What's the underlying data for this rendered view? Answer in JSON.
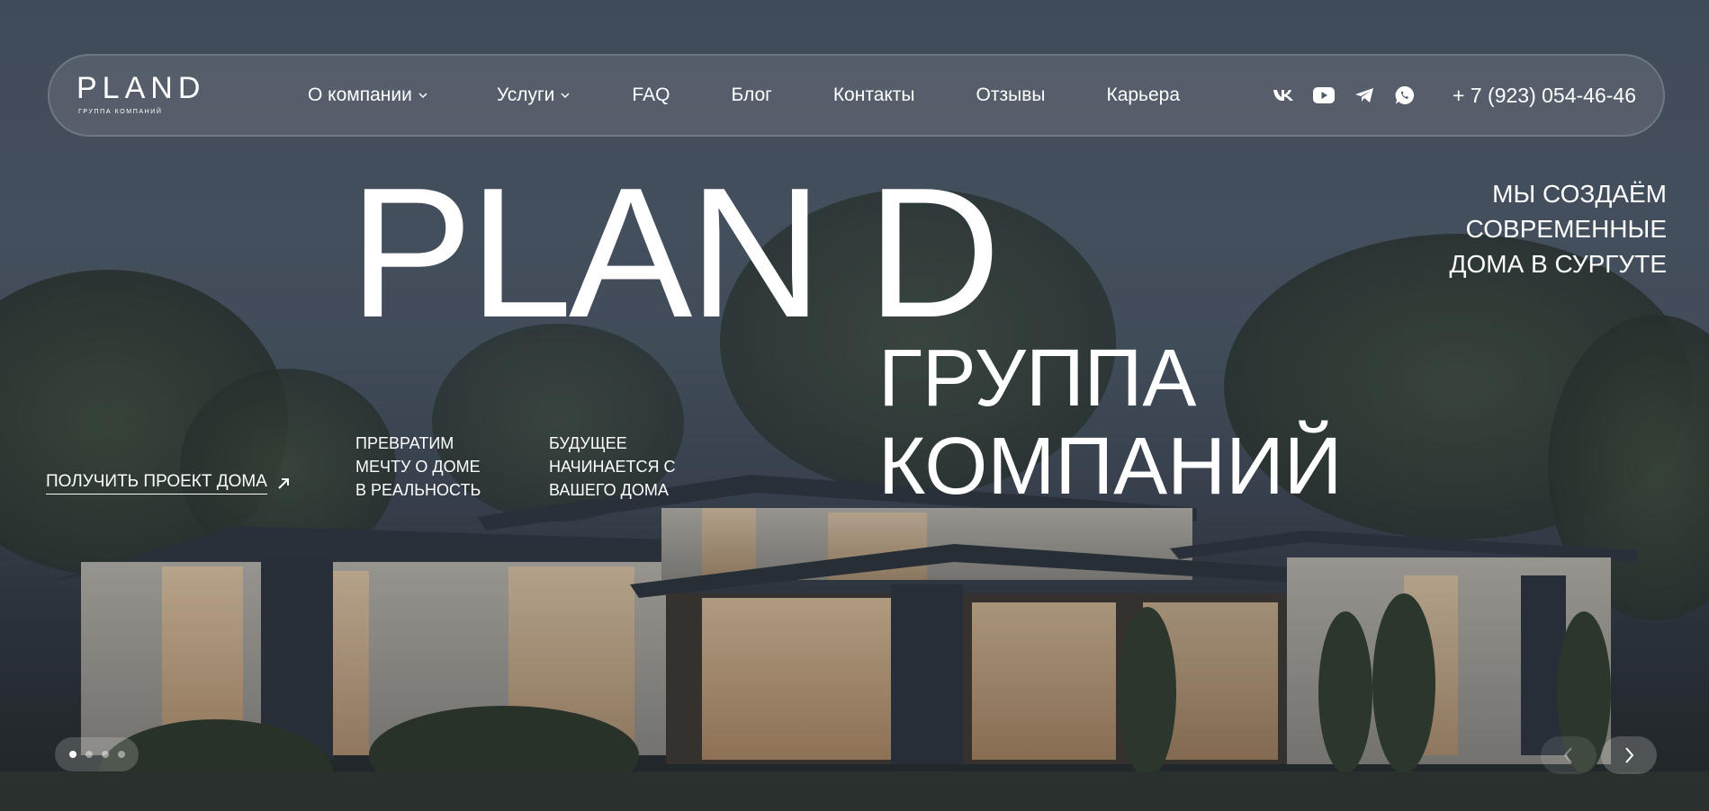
{
  "nav": {
    "logo_text": "PLAND",
    "logo_sub": "ГРУППА КОМПАНИЙ",
    "items": [
      {
        "label": "О компании",
        "dropdown": true
      },
      {
        "label": "Услуги",
        "dropdown": true
      },
      {
        "label": "FAQ",
        "dropdown": false
      },
      {
        "label": "Блог",
        "dropdown": false
      },
      {
        "label": "Контакты",
        "dropdown": false
      },
      {
        "label": "Отзывы",
        "dropdown": false
      },
      {
        "label": "Карьера",
        "dropdown": false
      }
    ],
    "socials": [
      "vk-icon",
      "youtube-icon",
      "telegram-icon",
      "whatsapp-icon"
    ],
    "phone": "+ 7 (923) 054-46-46"
  },
  "hero": {
    "title": "PLAN D",
    "subtitle_lines": [
      "ГРУППА",
      "КОМПАНИЙ"
    ],
    "tagline_lines": [
      "МЫ СОЗДАЁМ",
      "СОВРЕМЕННЫЕ",
      "ДОМА В СУРГУТЕ"
    ],
    "blurb1_lines": [
      "ПРЕВРАТИМ",
      "МЕЧТУ О ДОМЕ",
      "В РЕАЛЬНОСТЬ"
    ],
    "blurb2_lines": [
      "БУДУЩЕЕ",
      "НАЧИНАЕТСЯ С",
      "ВАШЕГО ДОМА"
    ],
    "cta_label": "ПОЛУЧИТЬ ПРОЕКТ ДОМА"
  },
  "slider": {
    "total": 4,
    "active": 1
  },
  "colors": {
    "text": "#ffffff",
    "sky": "#4a5563"
  }
}
